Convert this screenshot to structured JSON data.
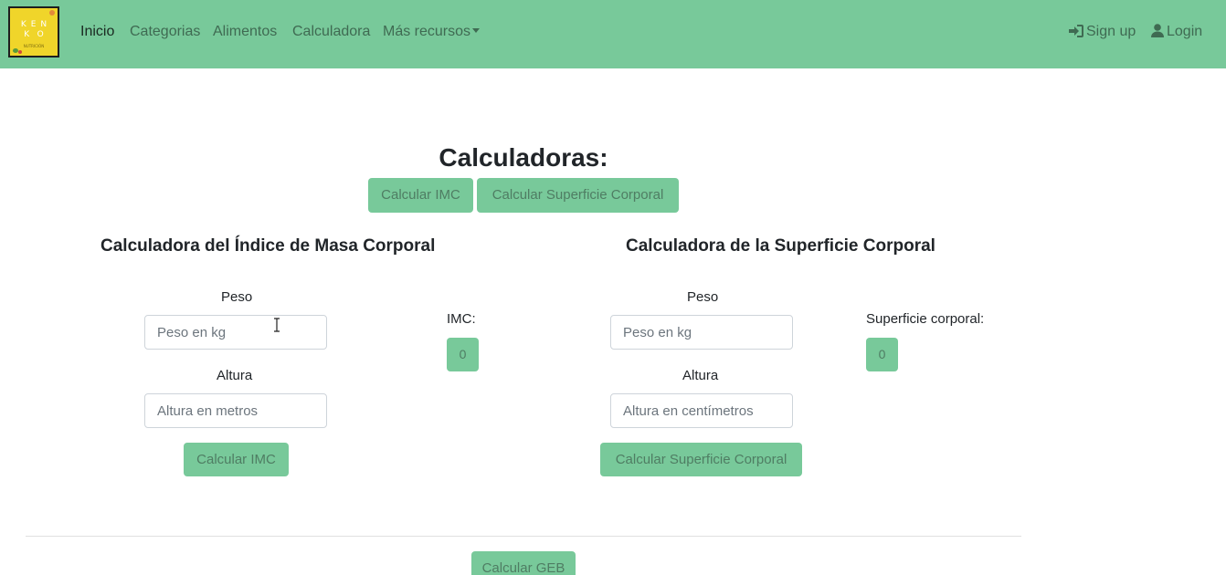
{
  "brand": {
    "logo_line1": "KEN",
    "logo_line2": "KO",
    "logo_line3": "NUTRICIÓN"
  },
  "nav": {
    "items": [
      {
        "label": "Inicio"
      },
      {
        "label": "Categorias"
      },
      {
        "label": "Alimentos"
      },
      {
        "label": "Calculadora"
      },
      {
        "label": "Más recursos"
      }
    ],
    "signup": "Sign up",
    "login": "Login"
  },
  "page": {
    "title": "Calculadoras:",
    "tab_imc": "Calcular IMC",
    "tab_sc": "Calcular Superficie Corporal"
  },
  "imc": {
    "title": "Calculadora del Índice de Masa Corporal",
    "peso_label": "Peso",
    "peso_placeholder": "Peso en kg",
    "altura_label": "Altura",
    "altura_placeholder": "Altura en metros",
    "button": "Calcular IMC",
    "result_label": "IMC:",
    "result_value": "0"
  },
  "sc": {
    "title": "Calculadora de la Superficie Corporal",
    "peso_label": "Peso",
    "peso_placeholder": "Peso en kg",
    "altura_label": "Altura",
    "altura_placeholder": "Altura en centímetros",
    "button": "Calcular Superficie Corporal",
    "result_label": "Superficie corporal:",
    "result_value": "0"
  },
  "geb": {
    "button": "Calcular GEB"
  },
  "colors": {
    "accent": "#78c99a",
    "accent_text": "#4f7d63",
    "nav_text": "#3f6a52"
  }
}
